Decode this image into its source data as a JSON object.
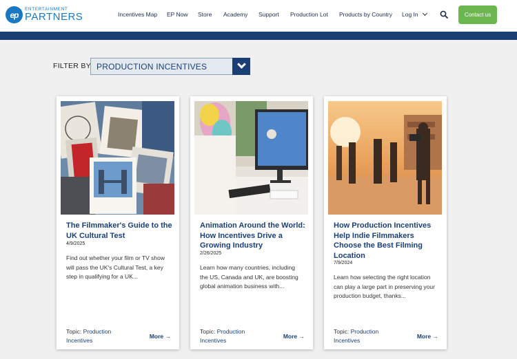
{
  "header": {
    "logo_mark": "ep",
    "logo_top": "ENTERTAINMENT",
    "logo_bottom": "PARTNERS",
    "nav": [
      {
        "label": "Incentives Map"
      },
      {
        "label": "EP Now"
      },
      {
        "label": "Store"
      },
      {
        "label": "Academy"
      },
      {
        "label": "Support"
      },
      {
        "label": "Production Lot"
      },
      {
        "label": "Products by Country"
      },
      {
        "label": "Log In"
      }
    ],
    "search_icon": "search-icon",
    "contact_label": "Contact us",
    "colors": {
      "brand_blue": "#1a78c2",
      "navy": "#1b3f73",
      "green": "#6cb64f"
    }
  },
  "filter": {
    "label": "FILTER BY",
    "value": "PRODUCTION INCENTIVES"
  },
  "cards": [
    {
      "title": "The Filmmaker's Guide to the UK Cultural Test",
      "date": "4/9/2025",
      "desc": "Find out whether your film or TV show will pass the UK's Cultural Test, a key step in qualifying for a UK...",
      "topic_label": "Topic:",
      "topic_value": "Production Incentives",
      "more": "More →"
    },
    {
      "title": "Animation Around the World: How Incentives Drive a Growing Industry",
      "date": "2/26/2025",
      "desc": "Learn how many countries, including the US, Canada and UK, are boosting global animation business with...",
      "topic_label": "Topic:",
      "topic_value": "Production Incentives",
      "more": "More →"
    },
    {
      "title": "How Production Incentives Help Indie Filmmakers Choose the Best Filming Location",
      "date": "7/9/2024",
      "desc": "Learn how selecting the right location can play a large part in preserving your production budget, thanks...",
      "topic_label": "Topic:",
      "topic_value": "Production Incentives",
      "more": "More →"
    }
  ]
}
